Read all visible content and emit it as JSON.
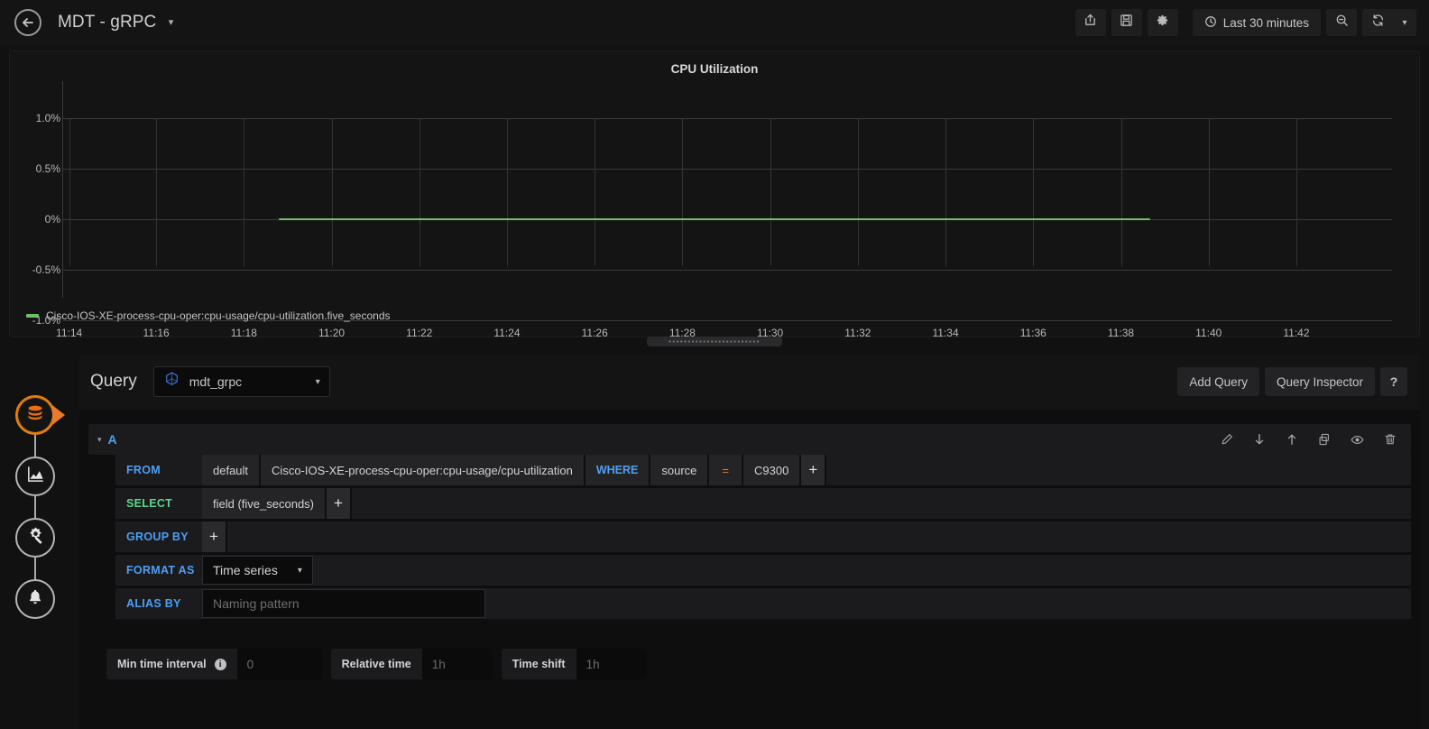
{
  "topnav": {
    "back_icon": "arrow-left-icon",
    "dashboard_title": "MDT - gRPC",
    "title_caret": "▾",
    "share_icon": "share-icon",
    "save_icon": "save-icon",
    "settings_icon": "gear-icon",
    "time_range": "Last 30 minutes",
    "clock_icon": "clock-icon",
    "zoom_out_icon": "zoom-out-icon",
    "refresh_icon": "refresh-icon",
    "refresh_caret": "▾"
  },
  "panel": {
    "title": "CPU Utilization",
    "drag_handle_dots": "▪▪▪▪▪▪▪▪▪▪▪▪▪▪▪▪▪▪▪▪▪▪▪▪"
  },
  "chart_data": {
    "type": "line",
    "title": "CPU Utilization",
    "xlabel": "",
    "ylabel": "",
    "grid": true,
    "legend_position": "bottom-left",
    "line_color": "#73bf69",
    "ylim": [
      -1.0,
      1.0
    ],
    "yticks": [
      "-1.0%",
      "-0.5%",
      "0%",
      "0.5%",
      "1.0%"
    ],
    "ytick_values": [
      -1.0,
      -0.5,
      0,
      0.5,
      1.0
    ],
    "xlim": [
      "11:13",
      "11:43"
    ],
    "xticks": [
      "11:14",
      "11:16",
      "11:18",
      "11:20",
      "11:22",
      "11:24",
      "11:26",
      "11:28",
      "11:30",
      "11:32",
      "11:34",
      "11:36",
      "11:38",
      "11:40",
      "11:42"
    ],
    "series": [
      {
        "name": "Cisco-IOS-XE-process-cpu-oper:cpu-usage/cpu-utilization.five_seconds",
        "color": "#73bf69",
        "x_start": "11:18.6",
        "x_end": "11:38.2",
        "values": [
          0,
          0,
          0,
          0,
          0,
          0,
          0,
          0,
          0,
          0,
          0
        ]
      }
    ]
  },
  "rail": [
    {
      "name": "queries-tab",
      "icon": "database-icon",
      "active": true
    },
    {
      "name": "visualization-tab",
      "icon": "graph-icon",
      "active": false
    },
    {
      "name": "general-settings-tab",
      "icon": "gear-wrench-icon",
      "active": false
    },
    {
      "name": "alert-tab",
      "icon": "bell-icon",
      "active": false
    }
  ],
  "query": {
    "label": "Query",
    "datasource": "mdt_grpc",
    "datasource_icon": "influxdb-icon",
    "datasource_caret": "▾",
    "add_query_label": "Add Query",
    "query_inspector_label": "Query Inspector",
    "help_label": "?",
    "row": {
      "collapse_caret": "▾",
      "letter": "A",
      "actions": [
        {
          "name": "edit-query-icon",
          "icon": "pencil-icon"
        },
        {
          "name": "move-query-down-icon",
          "icon": "arrow-down-icon"
        },
        {
          "name": "move-query-up-icon",
          "icon": "arrow-up-icon"
        },
        {
          "name": "duplicate-query-icon",
          "icon": "copy-icon"
        },
        {
          "name": "toggle-query-visibility-icon",
          "icon": "eye-icon"
        },
        {
          "name": "delete-query-icon",
          "icon": "trash-icon"
        }
      ]
    },
    "from": {
      "key": "FROM",
      "policy": "default",
      "measurement": "Cisco-IOS-XE-process-cpu-oper:cpu-usage/cpu-utilization",
      "where_keyword": "WHERE",
      "where_field": "source",
      "where_operator": "=",
      "where_value": "C9300",
      "add": "+"
    },
    "select": {
      "key": "SELECT",
      "field": "field (five_seconds)",
      "add": "+"
    },
    "group_by": {
      "key": "GROUP BY",
      "add": "+"
    },
    "format_as": {
      "key": "FORMAT AS",
      "value": "Time series",
      "caret": "▾"
    },
    "alias_by": {
      "key": "ALIAS BY",
      "value": "",
      "placeholder": "Naming pattern"
    },
    "options": {
      "min_time_interval_label": "Min time interval",
      "min_time_interval_info": "i",
      "min_time_interval_value": "",
      "min_time_interval_placeholder": "0",
      "relative_time_label": "Relative time",
      "relative_time_value": "",
      "relative_time_placeholder": "1h",
      "time_shift_label": "Time shift",
      "time_shift_value": "",
      "time_shift_placeholder": "1h"
    }
  }
}
